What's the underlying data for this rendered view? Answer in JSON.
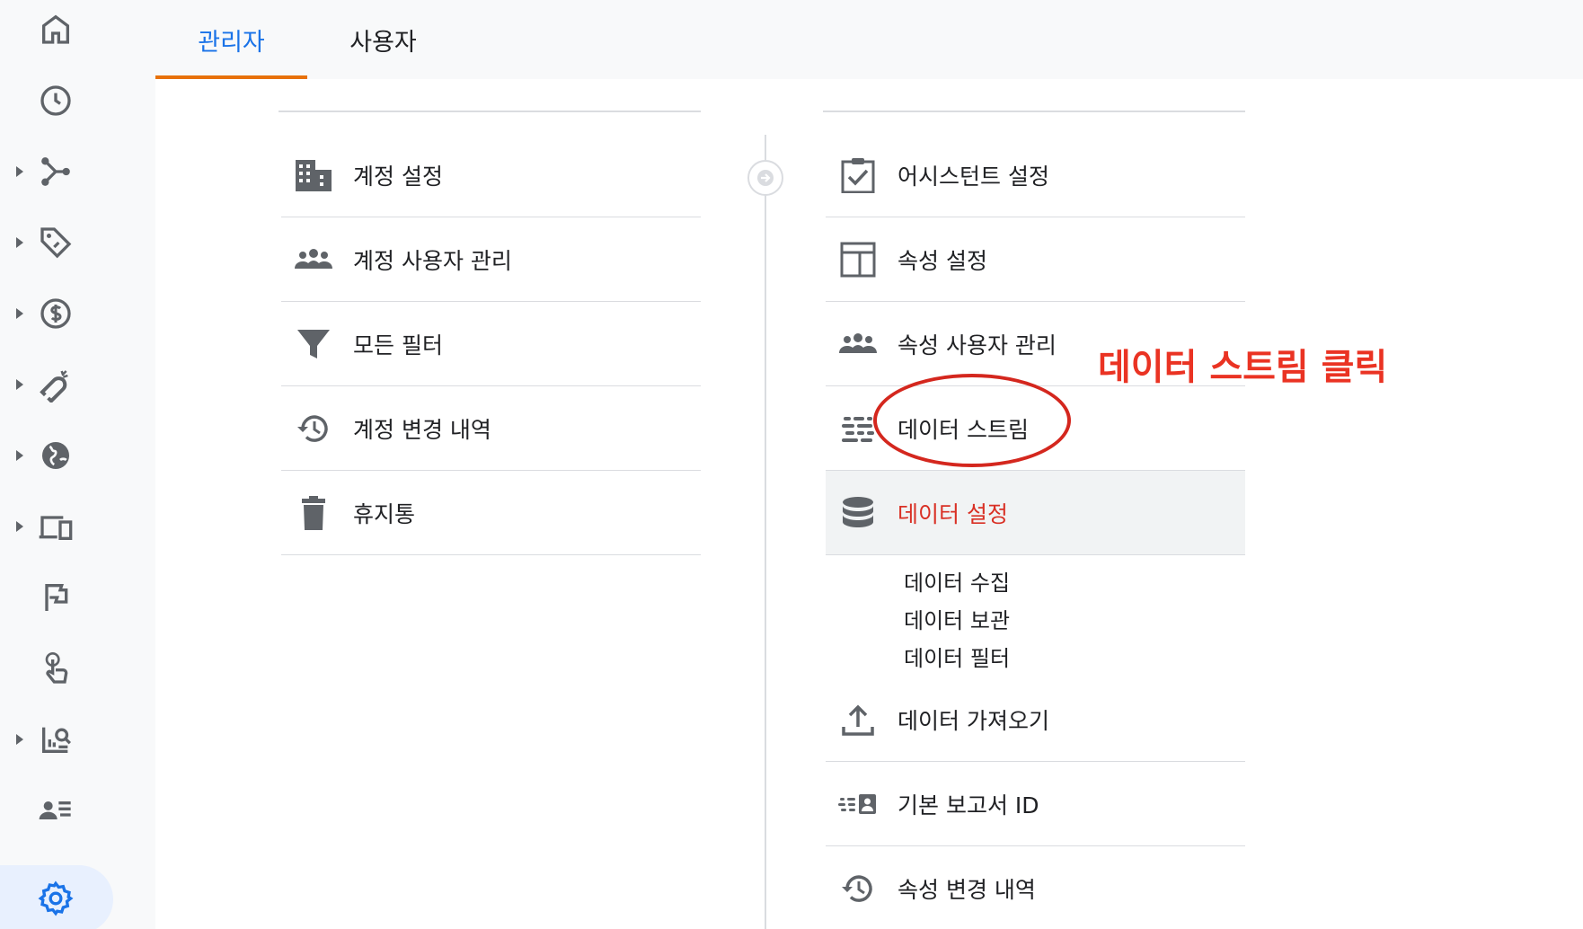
{
  "tabs": {
    "admin": "관리자",
    "user": "사용자"
  },
  "left_menu": [
    {
      "label": "계정 설정",
      "icon": "building-icon"
    },
    {
      "label": "계정 사용자 관리",
      "icon": "people-icon"
    },
    {
      "label": "모든 필터",
      "icon": "filter-icon"
    },
    {
      "label": "계정 변경 내역",
      "icon": "history-icon"
    },
    {
      "label": "휴지통",
      "icon": "trash-icon"
    }
  ],
  "right_menu": [
    {
      "label": "어시스턴트 설정",
      "icon": "clipboard-check-icon"
    },
    {
      "label": "속성 설정",
      "icon": "layout-icon"
    },
    {
      "label": "속성 사용자 관리",
      "icon": "people-icon"
    },
    {
      "label": "데이터 스트림",
      "icon": "streams-icon"
    },
    {
      "label": "데이터 설정",
      "icon": "database-icon"
    },
    {
      "label": "데이터 가져오기",
      "icon": "upload-icon"
    },
    {
      "label": "기본 보고서 ID",
      "icon": "report-id-icon"
    },
    {
      "label": "속성 변경 내역",
      "icon": "history-icon"
    }
  ],
  "data_settings_sub": [
    "데이터 수집",
    "데이터 보관",
    "데이터 필터"
  ],
  "annotation": "데이터 스트림 클릭",
  "colors": {
    "accent_blue": "#1a73e8",
    "tab_underline": "#e8710a",
    "active_red": "#d93025",
    "annotation_red": "#ea3323",
    "icon_gray": "#5f6368"
  },
  "rail_icons": [
    "home-icon",
    "clock-icon",
    "flow-icon",
    "tag-icon",
    "dollar-icon",
    "magnet-icon",
    "globe-icon",
    "devices-icon",
    "flag-icon",
    "touch-icon",
    "report-search-icon",
    "audience-icon",
    "settings-icon"
  ]
}
